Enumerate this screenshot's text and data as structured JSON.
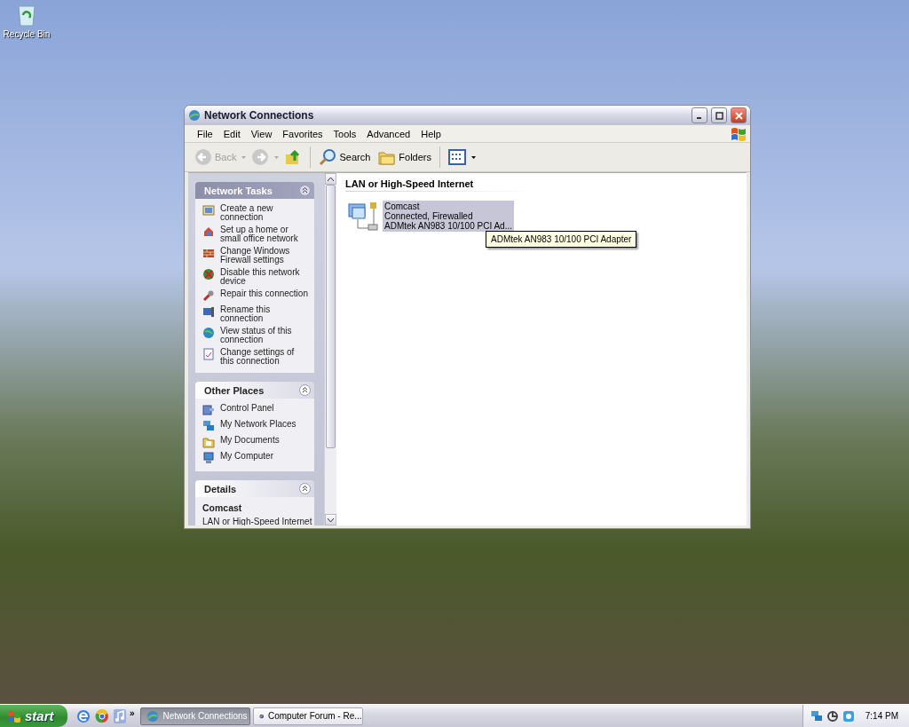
{
  "desktop": {
    "icons": [
      {
        "label": "Recycle Bin"
      }
    ]
  },
  "window": {
    "title": "Network Connections",
    "menu": [
      "File",
      "Edit",
      "View",
      "Favorites",
      "Tools",
      "Advanced",
      "Help"
    ],
    "toolbar": [
      {
        "kind": "back",
        "label": "Back",
        "disabled": true
      },
      {
        "kind": "forward",
        "disabled": true
      },
      {
        "kind": "up",
        "disabled": false
      },
      {
        "kind": "search",
        "label": "Search",
        "disabled": false
      },
      {
        "kind": "folders",
        "label": "Folders",
        "disabled": false
      },
      {
        "kind": "views",
        "disabled": false
      }
    ],
    "panels": [
      {
        "title": "Network Tasks",
        "kind": "tasks",
        "expanded": true,
        "items": [
          {
            "kind": "new-connection",
            "label": "Create a new connection"
          },
          {
            "kind": "home-network",
            "label": "Set up a home or small office network"
          },
          {
            "kind": "firewall",
            "label": "Change Windows Firewall settings"
          },
          {
            "kind": "disable",
            "label": "Disable this network device"
          },
          {
            "kind": "repair",
            "label": "Repair this connection"
          },
          {
            "kind": "rename",
            "label": "Rename this connection"
          },
          {
            "kind": "status",
            "label": "View status of this connection"
          },
          {
            "kind": "settings",
            "label": "Change settings of this connection"
          }
        ]
      },
      {
        "title": "Other Places",
        "kind": "places",
        "expanded": true,
        "items": [
          {
            "kind": "control-panel",
            "label": "Control Panel"
          },
          {
            "kind": "network-places",
            "label": "My Network Places"
          },
          {
            "kind": "documents",
            "label": "My Documents"
          },
          {
            "kind": "computer",
            "label": "My Computer"
          }
        ]
      },
      {
        "title": "Details",
        "kind": "details",
        "expanded": true,
        "name": "Comcast",
        "lines": [
          "LAN or High-Speed Internet"
        ]
      }
    ],
    "group_header": "LAN or High-Speed Internet",
    "connections": [
      {
        "name": "Comcast",
        "status": "Connected, Firewalled",
        "device": "ADMtek AN983 10/100 PCI Ad...",
        "selected": true
      }
    ],
    "tooltip": "ADMtek AN983 10/100 PCI Adapter"
  },
  "taskbar": {
    "start": "start",
    "more": "»",
    "tasks": [
      {
        "kind": "network",
        "label": "Network Connections",
        "selected": true
      },
      {
        "kind": "browser",
        "label": "Computer Forum - Re...",
        "selected": false
      }
    ],
    "clock": "7:14 PM"
  }
}
